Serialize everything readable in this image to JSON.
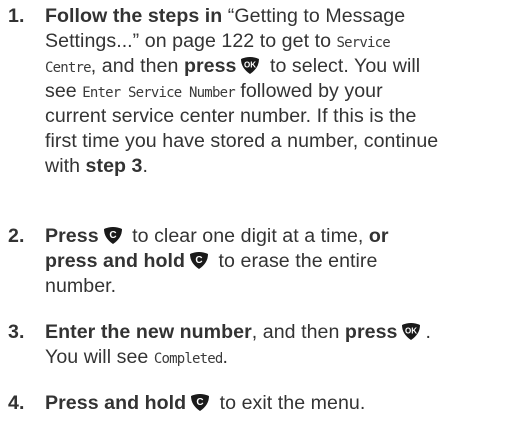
{
  "steps": [
    {
      "number": "1.",
      "l1_bold": "Follow the steps in",
      "l1_text": " “Getting to Message",
      "l2_text": "Settings...” on page 122 to get to ",
      "l2_lcd": "Service",
      "l3_lcd": "Centre",
      "l3_text1": ", and then ",
      "l3_bold": "press",
      "l3_text2": " to select. You will",
      "l4_text1": "see ",
      "l4_lcd": "Enter Service Number",
      "l4_text2": " followed by your",
      "l5_text": "current service center number. If this is the",
      "l6_text": "first time you have stored a number, continue",
      "l7_text1": "with ",
      "l7_bold": "step 3",
      "l7_text2": "."
    },
    {
      "number": "2.",
      "l1_bold": "Press",
      "l1_text": " to clear one digit at a time, ",
      "l1_bold2": "or",
      "l2_bold": "press and hold",
      "l2_text": " to erase the entire",
      "l3_text": "number."
    },
    {
      "number": "3.",
      "l1_bold": "Enter the new number",
      "l1_text": ", and then ",
      "l1_bold2": "press",
      "l1_text2": ".",
      "l2_text": "You will see ",
      "l2_lcd": "Completed",
      "l2_text2": "."
    },
    {
      "number": "4.",
      "l1_bold": "Press and hold",
      "l1_text": " to exit the menu."
    }
  ],
  "keys": {
    "ok": {
      "icon": "ok-key-icon",
      "label": "OK"
    },
    "clear": {
      "icon": "clear-key-icon",
      "label": "C"
    }
  },
  "colors": {
    "text": "#333333",
    "key_fill": "#1a1a1a",
    "key_text": "#ffffff"
  }
}
